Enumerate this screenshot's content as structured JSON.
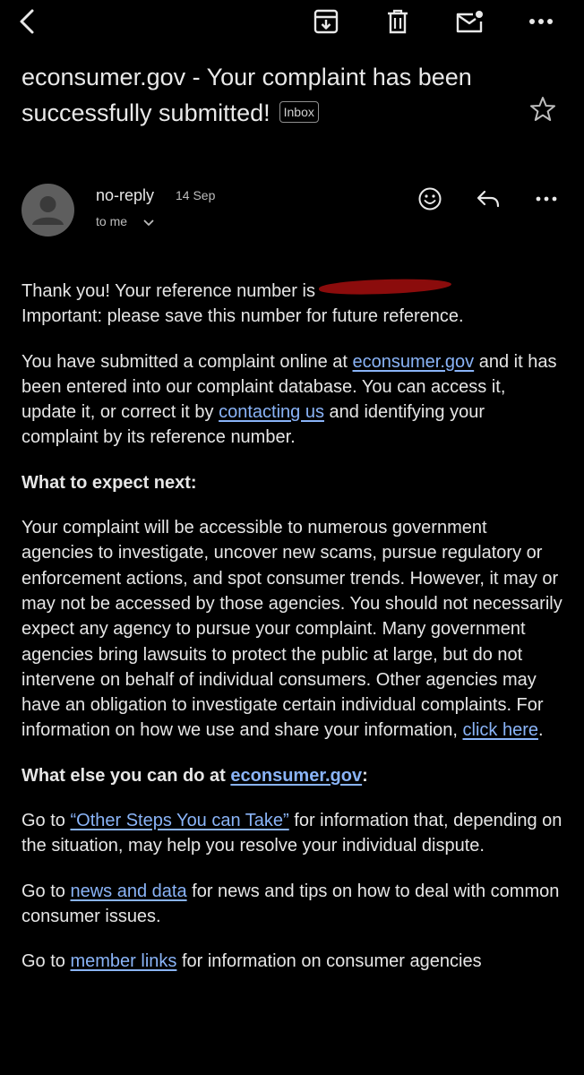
{
  "email": {
    "subject": "econsumer.gov - Your complaint has been successfully submitted!",
    "label": "Inbox",
    "sender": "no-reply",
    "date": "14 Sep",
    "recipient": "to me"
  },
  "icons": {
    "toolbar": [
      "back-arrow-icon",
      "archive-icon",
      "delete-icon",
      "mark-unread-icon",
      "more-vert-icon"
    ],
    "header": [
      "star-icon",
      "avatar-icon",
      "chevron-down-icon",
      "emoji-react-icon",
      "reply-icon",
      "more-horiz-icon"
    ]
  },
  "colors": {
    "background": "#000000",
    "text": "#e6e6e6",
    "link": "#8ab4f8",
    "redaction": "#8b0c0c"
  },
  "body": {
    "p1": {
      "t1": "Thank you! Your reference number is",
      "t2": "Important: please save this number for future reference."
    },
    "p2": {
      "t1": "You have submitted a complaint online at ",
      "link1": "econsumer.gov",
      "t2": " and it has been entered into our complaint database. You can access it, update it, or correct it by ",
      "link2": "contacting us",
      "t3": " and identifying your complaint by its reference number."
    },
    "h1": "What to expect next:",
    "p3": {
      "t1": "Your complaint will be accessible to numerous government agencies to investigate, uncover new scams, pursue regulatory or enforcement actions, and spot consumer trends. However, it may or may not be accessed by those agencies. You should not necessarily expect any agency to pursue your complaint. Many government agencies bring lawsuits to protect the public at large, but do not intervene on behalf of individual consumers. Other agencies may have an obligation to investigate certain individual complaints. For information on how we use and share your information, ",
      "link": "click here",
      "t2": "."
    },
    "h2": {
      "t1": "What else you can do at ",
      "link": "econsumer.gov",
      "t2": ":"
    },
    "p4": {
      "t1": "Go to ",
      "link": "“Other Steps You can Take”",
      "t2": " for information that, depending on the situation, may help you resolve your individual dispute."
    },
    "p5": {
      "t1": "Go to ",
      "link": "news and data",
      "t2": " for news and tips on how to deal with common consumer issues."
    },
    "p6": {
      "t1": "Go to ",
      "link": "member links",
      "t2": " for information on consumer agencies"
    }
  }
}
